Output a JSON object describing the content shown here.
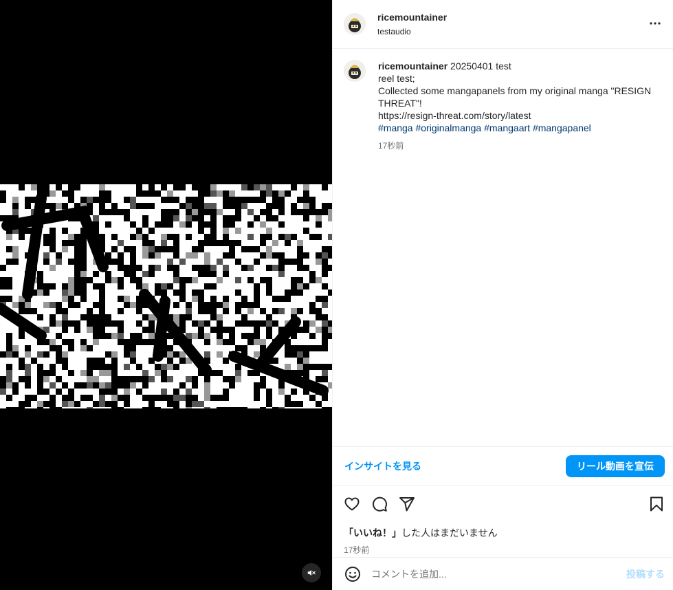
{
  "media": {
    "mute_icon": "speaker-muted-icon"
  },
  "header": {
    "username": "ricemountainer",
    "audio": "testaudio",
    "more_icon": "more-horizontal-icon"
  },
  "caption": {
    "username": "ricemountainer",
    "first_line_text": "20250401 test",
    "lines": [
      "reel test;",
      "Collected some mangapanels from my original manga \"RESIGN THREAT\"!",
      "https://resign-threat.com/story/latest"
    ],
    "hashtags": [
      "#manga",
      "#originalmanga",
      "#mangaart",
      "#mangapanel"
    ],
    "time": "17秒前"
  },
  "insights": {
    "link_label": "インサイトを見る",
    "promote_label": "リール動画を宣伝"
  },
  "actions": {
    "icons": [
      "heart-icon",
      "comment-icon",
      "share-icon",
      "bookmark-icon"
    ],
    "likes_bold": "「いいね！」",
    "likes_rest": "した人はまだいません",
    "time": "17秒前"
  },
  "comment_bar": {
    "emoji_icon": "emoji-icon",
    "placeholder": "コメントを追加...",
    "post_label": "投稿する"
  },
  "colors": {
    "accent": "#0095f6",
    "link": "#00376b",
    "muted": "#737373",
    "post_disabled": "#b2dffc"
  }
}
